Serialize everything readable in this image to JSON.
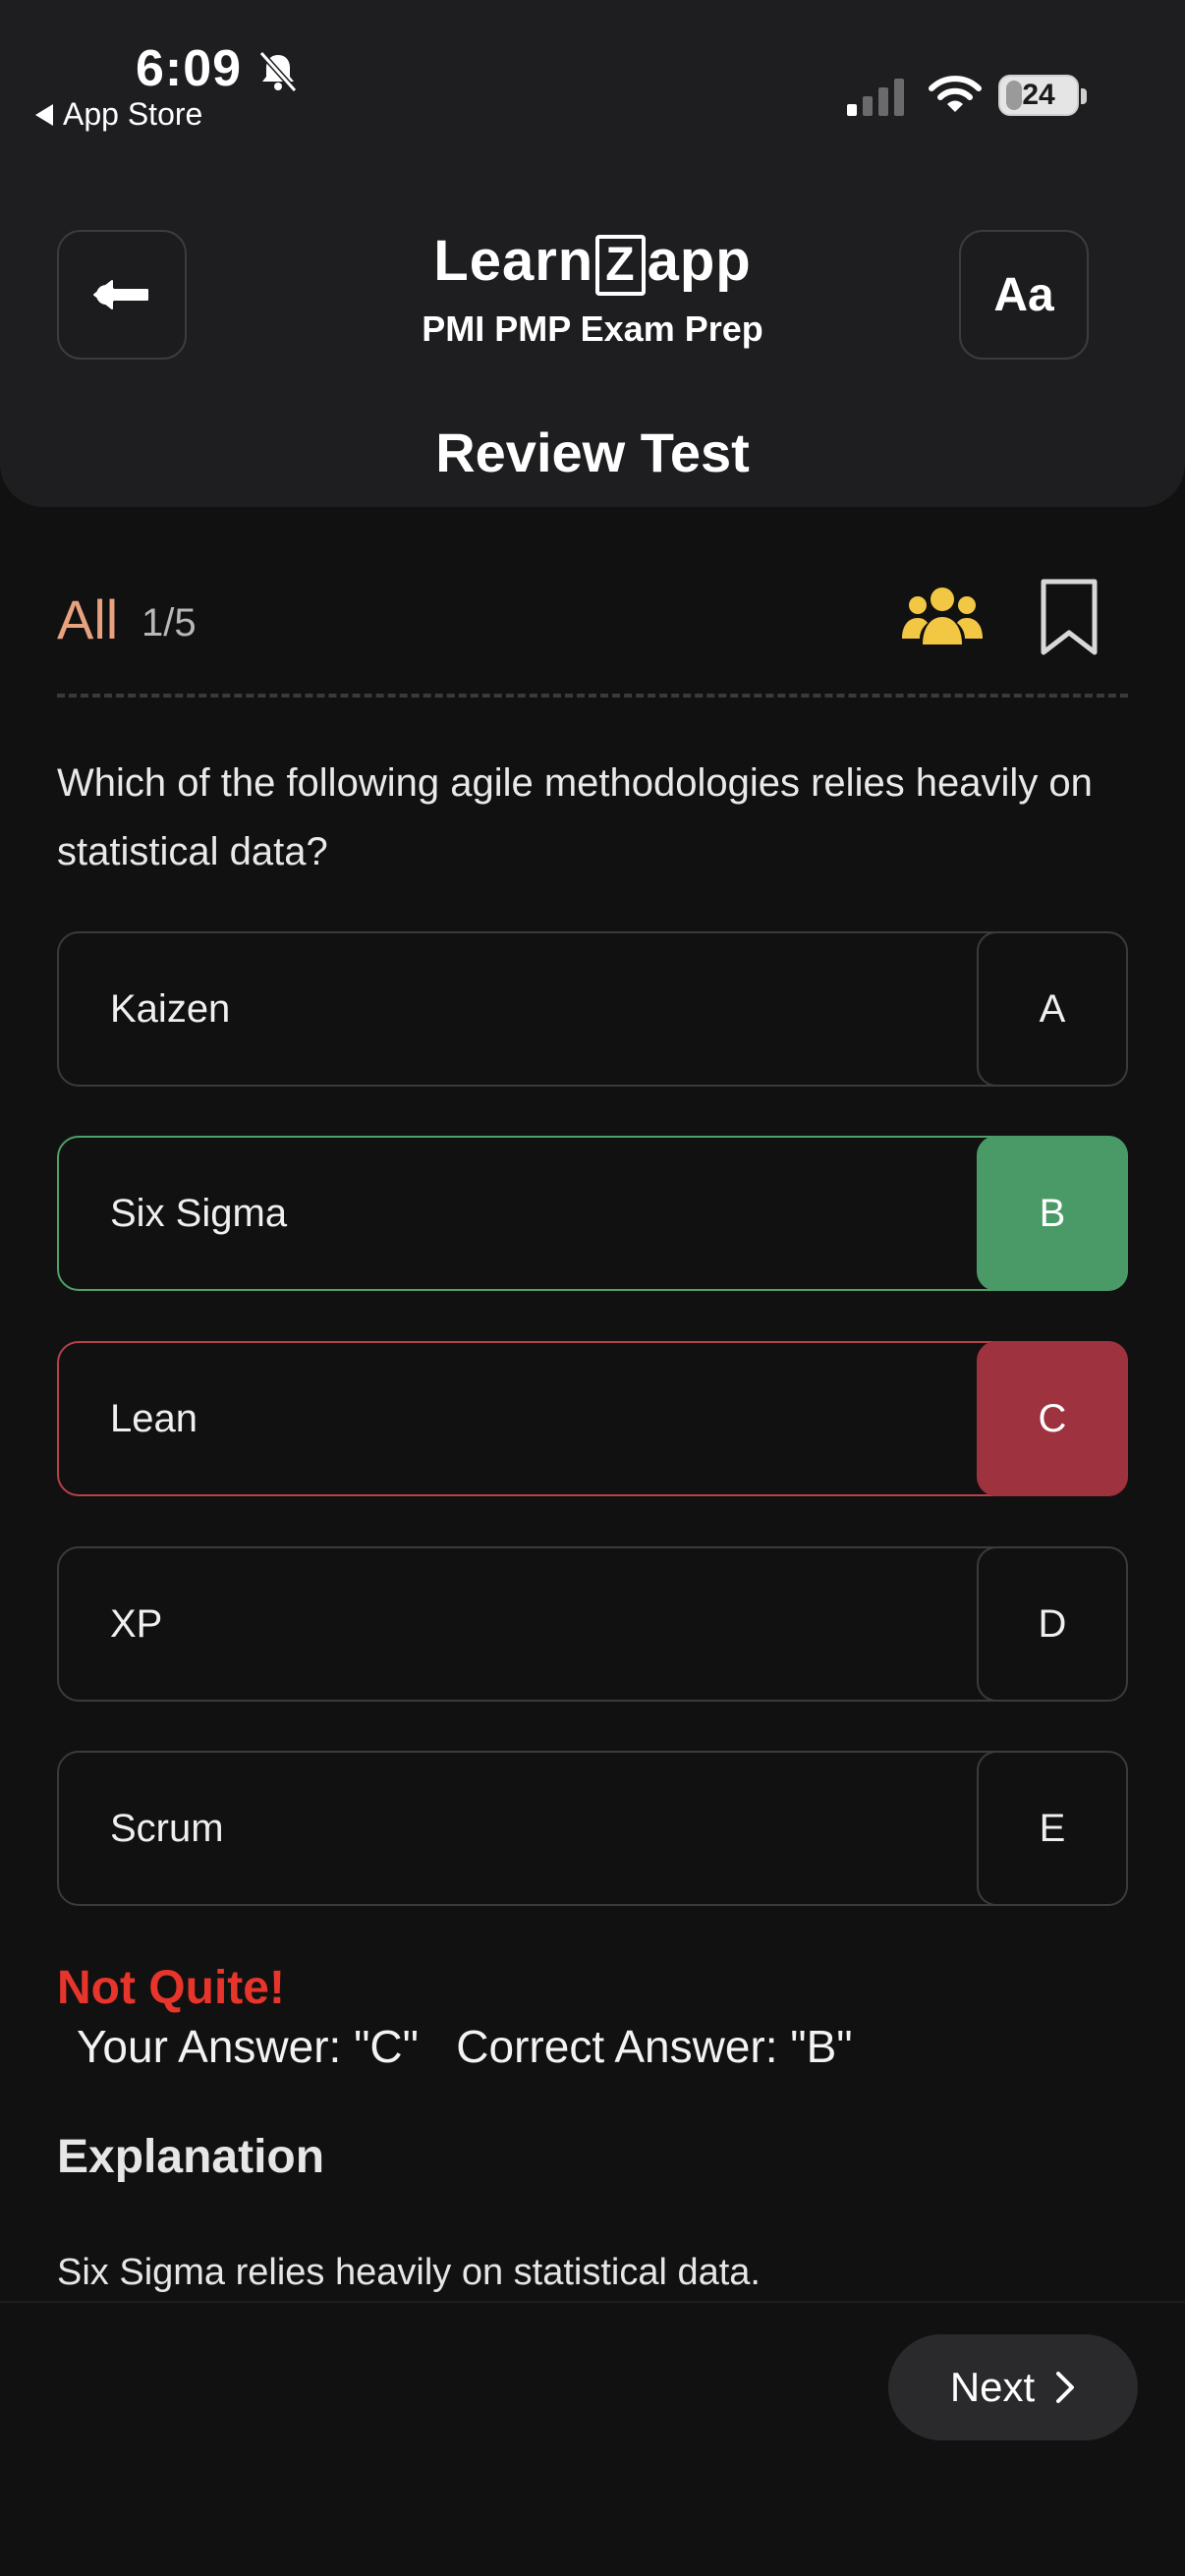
{
  "status_bar": {
    "time": "6:09",
    "back_app": "App Store",
    "battery": "24",
    "battery_level_percent": 24
  },
  "header": {
    "logo_pre": "Learn",
    "logo_box": "Z",
    "logo_post": "app",
    "subtitle": "PMI  PMP  Exam Prep",
    "title": "Review Test",
    "font_button": "Aa"
  },
  "question_header": {
    "filter": "All",
    "counter": "1/5"
  },
  "question": {
    "text": "Which of the following agile methodologies relies heavily on statistical data?"
  },
  "options": [
    {
      "text": "Kaizen",
      "letter": "A",
      "state": "neutral"
    },
    {
      "text": "Six Sigma",
      "letter": "B",
      "state": "correct"
    },
    {
      "text": "Lean",
      "letter": "C",
      "state": "wrong"
    },
    {
      "text": "XP",
      "letter": "D",
      "state": "neutral"
    },
    {
      "text": "Scrum",
      "letter": "E",
      "state": "neutral"
    }
  ],
  "result": {
    "title": "Not Quite!",
    "answer_line": " Your Answer: \"C\"   Correct Answer: \"B\""
  },
  "explanation": {
    "title": "Explanation",
    "text": "Six Sigma relies heavily on statistical data."
  },
  "footer": {
    "next_label": "Next"
  },
  "colors": {
    "correct": "#4a9a68",
    "wrong": "#9e323e",
    "filter_accent": "#e8a27d",
    "result_red": "#e8352c",
    "users_icon": "#f2c744"
  }
}
